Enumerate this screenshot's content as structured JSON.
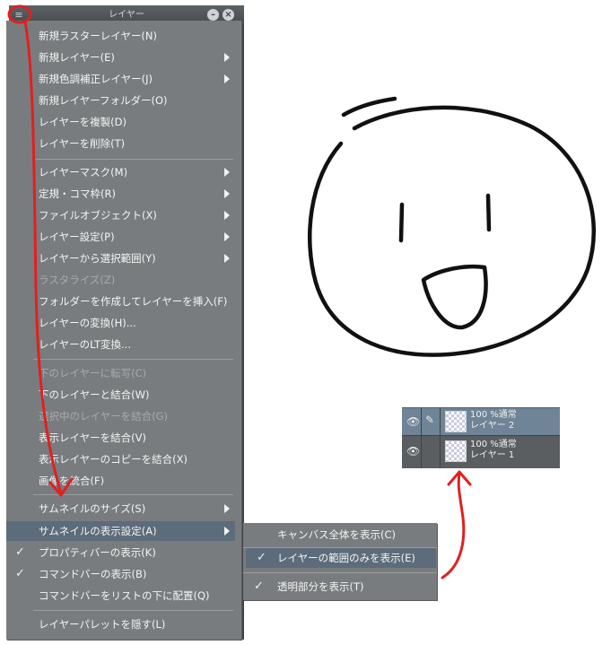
{
  "window": {
    "title": "レイヤー",
    "minimize": "–",
    "close": "×"
  },
  "menu": {
    "items": [
      {
        "label": "新規ラスターレイヤー(N)"
      },
      {
        "label": "新規レイヤー(E)"
      },
      {
        "label": "新規色調補正レイヤー(J)"
      },
      {
        "label": "新規レイヤーフォルダー(O)"
      },
      {
        "label": "レイヤーを複製(D)"
      },
      {
        "label": "レイヤーを削除(T)"
      },
      {
        "label": "レイヤーマスク(M)"
      },
      {
        "label": "定規・コマ枠(R)"
      },
      {
        "label": "ファイルオブジェクト(X)"
      },
      {
        "label": "レイヤー設定(P)"
      },
      {
        "label": "レイヤーから選択範囲(Y)"
      },
      {
        "label": "ラスタライズ(Z)"
      },
      {
        "label": "フォルダーを作成してレイヤーを挿入(F)"
      },
      {
        "label": "レイヤーの変換(H)..."
      },
      {
        "label": "レイヤーのLT変換..."
      },
      {
        "label": "下のレイヤーに転写(C)"
      },
      {
        "label": "下のレイヤーと結合(W)"
      },
      {
        "label": "選択中のレイヤーを結合(G)"
      },
      {
        "label": "表示レイヤーを結合(V)"
      },
      {
        "label": "表示レイヤーのコピーを結合(X)"
      },
      {
        "label": "画像を統合(F)"
      },
      {
        "label": "サムネイルのサイズ(S)"
      },
      {
        "label": "サムネイルの表示設定(A)"
      },
      {
        "label": "プロパティバーの表示(K)"
      },
      {
        "label": "コマンドバーの表示(B)"
      },
      {
        "label": "コマンドバーをリストの下に配置(Q)"
      },
      {
        "label": "レイヤーパレットを隠す(L)"
      }
    ],
    "check_mark": "✓"
  },
  "submenu": {
    "items": [
      {
        "label": "キャンバス全体を表示(C)"
      },
      {
        "label": "レイヤーの範囲のみを表示(E)"
      },
      {
        "label": "透明部分を表示(T)"
      }
    ]
  },
  "layers": [
    {
      "name": "レイヤー 2",
      "info": "100 %通常",
      "selected": true
    },
    {
      "name": "レイヤー 1",
      "info": "100 %通常",
      "selected": false
    }
  ],
  "icons": {
    "eye": "👁",
    "pen": "✎",
    "menu": "≡"
  },
  "colors": {
    "annotation": "#e02020",
    "menu_bg": "#797c7e",
    "highlight": "#5d6c7a"
  }
}
